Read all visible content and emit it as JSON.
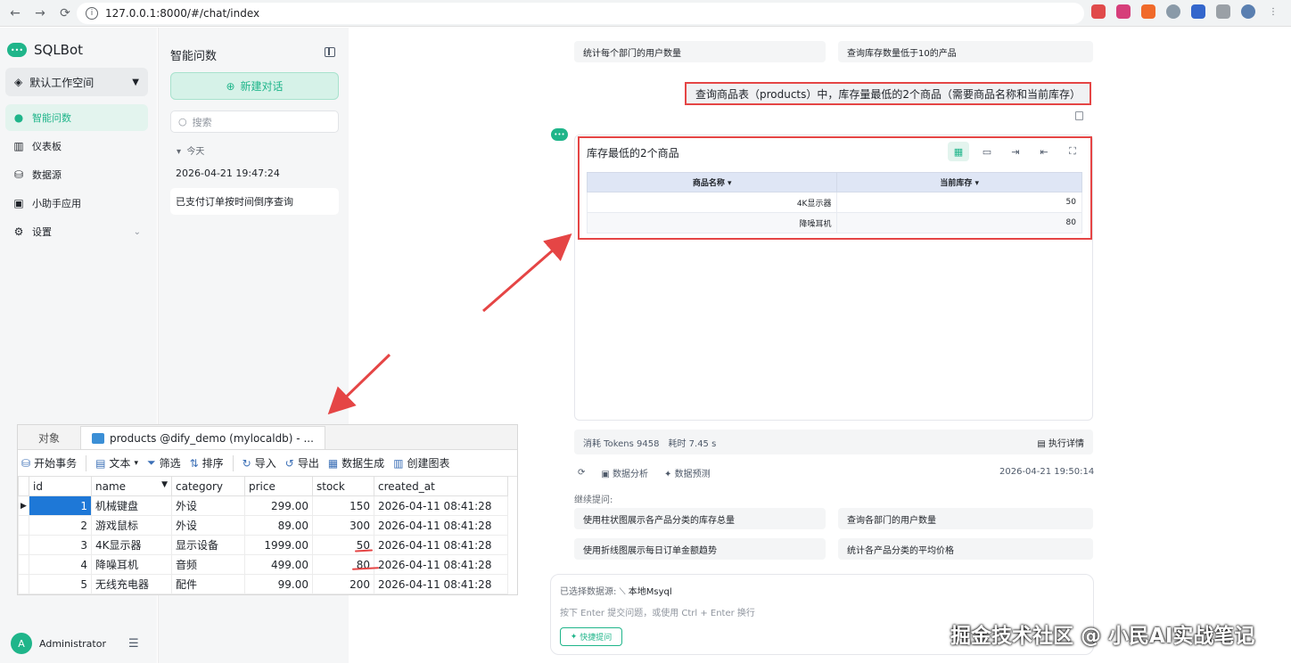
{
  "browser": {
    "url": "127.0.0.1:8000/#/chat/index",
    "back_icon": "←",
    "forward_icon": "→",
    "reload_icon": "⟳"
  },
  "sidebar": {
    "app_name": "SQLBot",
    "workspace": "默认工作空间",
    "items": [
      {
        "label": "智能问数",
        "icon": "chat-icon",
        "glyph": "●"
      },
      {
        "label": "仪表板",
        "icon": "chart-icon",
        "glyph": "▥"
      },
      {
        "label": "数据源",
        "icon": "database-icon",
        "glyph": "⛁"
      },
      {
        "label": "小助手应用",
        "icon": "app-icon",
        "glyph": "▣"
      },
      {
        "label": "设置",
        "icon": "gear-icon",
        "glyph": "⚙"
      }
    ],
    "user": "Administrator"
  },
  "conversations": {
    "title": "智能问数",
    "new_chat": "新建对话",
    "search_placeholder": "搜索",
    "group": "今天",
    "items": [
      "2026-04-21 19:47:24",
      "已支付订单按时间倒序查询"
    ]
  },
  "chat": {
    "top_suggestions": [
      "统计每个部门的用户数量",
      "查询库存数量低于10的产品"
    ],
    "user_message": "查询商品表（products）中，库存量最低的2个商品（需要商品名称和当前库存）",
    "result": {
      "title": "库存最低的2个商品",
      "columns": [
        "商品名称",
        "当前库存"
      ],
      "rows": [
        [
          "4K显示器",
          "50"
        ],
        [
          "降噪耳机",
          "80"
        ]
      ]
    },
    "meta": {
      "tokens": "消耗 Tokens 9458",
      "time": "耗时 7.45 s",
      "detail": "执行详情"
    },
    "actions": {
      "analyze": "数据分析",
      "predict": "数据预测"
    },
    "timestamp": "2026-04-21 19:50:14",
    "continue_label": "继续提问:",
    "followups": [
      "使用柱状图展示各产品分类的库存总量",
      "查询各部门的用户数量",
      "使用折线图展示每日订单金额趋势",
      "统计各产品分类的平均价格"
    ],
    "input": {
      "datasource_label": "已选择数据源:",
      "datasource": "本地Msyql",
      "hint": "按下 Enter 提交问题，或使用 Ctrl + Enter 换行",
      "quick_ask": "快捷提问"
    }
  },
  "watermark": "掘金技术社区 @ 小民AI实战笔记",
  "navicat": {
    "tabs": [
      "对象",
      "products @dify_demo (mylocaldb) - ..."
    ],
    "toolbar": [
      "开始事务",
      "文本",
      "筛选",
      "排序",
      "导入",
      "导出",
      "数据生成",
      "创建图表"
    ],
    "columns": [
      "id",
      "name",
      "category",
      "price",
      "stock",
      "created_at"
    ],
    "rows": [
      [
        "1",
        "机械键盘",
        "外设",
        "299.00",
        "150",
        "2026-04-11 08:41:28"
      ],
      [
        "2",
        "游戏鼠标",
        "外设",
        "89.00",
        "300",
        "2026-04-11 08:41:28"
      ],
      [
        "3",
        "4K显示器",
        "显示设备",
        "1999.00",
        "50",
        "2026-04-11 08:41:28"
      ],
      [
        "4",
        "降噪耳机",
        "音频",
        "499.00",
        "80",
        "2026-04-11 08:41:28"
      ],
      [
        "5",
        "无线充电器",
        "配件",
        "99.00",
        "200",
        "2026-04-11 08:41:28"
      ]
    ]
  },
  "colors": {
    "accent": "#1fb58a",
    "highlight": "#e54545",
    "selection": "#1e78d7"
  }
}
